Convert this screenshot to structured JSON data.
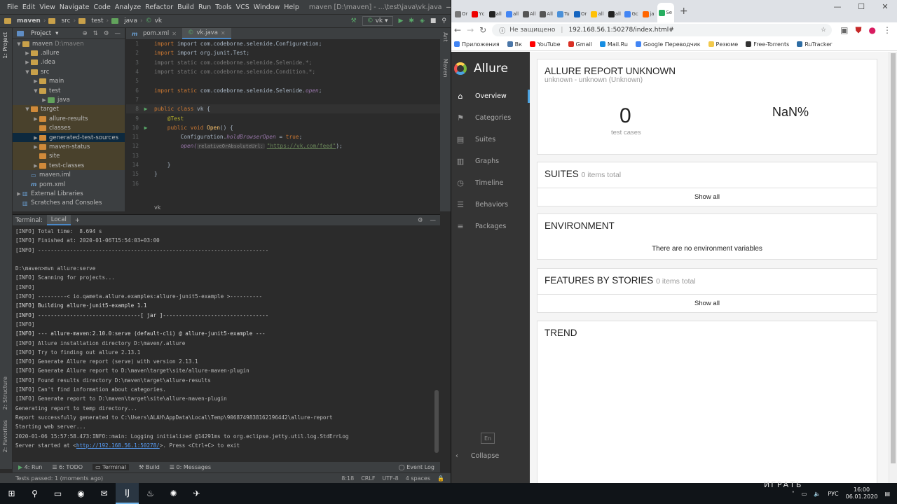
{
  "ide": {
    "menu": [
      "File",
      "Edit",
      "View",
      "Navigate",
      "Code",
      "Analyze",
      "Refactor",
      "Build",
      "Run",
      "Tools",
      "VCS",
      "Window",
      "Help"
    ],
    "title": "maven [D:\\maven] - ...\\test\\java\\vk.java",
    "nav": [
      "maven",
      "src",
      "test",
      "java",
      "vk"
    ],
    "run_config": "vk",
    "project_label": "Project",
    "tree": [
      {
        "label": "maven",
        "dim": "D:\\maven",
        "indent": 0,
        "arrow": "▼",
        "icon": "fold"
      },
      {
        "label": ".allure",
        "indent": 1,
        "arrow": "▶",
        "icon": "fold"
      },
      {
        "label": ".idea",
        "indent": 1,
        "arrow": "▶",
        "icon": "fold"
      },
      {
        "label": "src",
        "indent": 1,
        "arrow": "▼",
        "icon": "fold"
      },
      {
        "label": "main",
        "indent": 2,
        "arrow": "▶",
        "icon": "fold"
      },
      {
        "label": "test",
        "indent": 2,
        "arrow": "▼",
        "icon": "fold"
      },
      {
        "label": "java",
        "indent": 3,
        "arrow": "▶",
        "icon": "fold green"
      },
      {
        "label": "target",
        "indent": 1,
        "arrow": "▼",
        "icon": "fold orange",
        "ex": true
      },
      {
        "label": "allure-results",
        "indent": 2,
        "arrow": "▶",
        "icon": "fold orange",
        "ex": true
      },
      {
        "label": "classes",
        "indent": 2,
        "arrow": "",
        "icon": "fold orange",
        "ex": true
      },
      {
        "label": "generated-test-sources",
        "indent": 2,
        "arrow": "▶",
        "icon": "fold orange",
        "sel": true
      },
      {
        "label": "maven-status",
        "indent": 2,
        "arrow": "▶",
        "icon": "fold orange",
        "ex": true
      },
      {
        "label": "site",
        "indent": 2,
        "arrow": "",
        "icon": "fold orange",
        "ex": true
      },
      {
        "label": "test-classes",
        "indent": 2,
        "arrow": "▶",
        "icon": "fold orange",
        "ex": true
      },
      {
        "label": "maven.iml",
        "indent": 1,
        "arrow": "",
        "icon": "file"
      },
      {
        "label": "pom.xml",
        "indent": 1,
        "arrow": "",
        "icon": "m"
      },
      {
        "label": "External Libraries",
        "indent": 0,
        "arrow": "▶",
        "icon": "lib"
      },
      {
        "label": "Scratches and Consoles",
        "indent": 0,
        "arrow": "",
        "icon": "lib"
      }
    ],
    "tabs": [
      {
        "label": "pom.xml",
        "icon": "m"
      },
      {
        "label": "vk.java",
        "icon": "c",
        "active": true
      }
    ],
    "code": {
      "l1": "import com.codeborne.selenide.Configuration;",
      "l2": "import org.junit.Test;",
      "l3": "import static com.codeborne.selenide.Selenide.*;",
      "l4": "import static com.codeborne.selenide.Condition.*;",
      "l6a": "import static ",
      "l6b": "com.codeborne.selenide.Selenide.",
      "l6c": "open",
      "l8a": "public class ",
      "l8b": "vk {",
      "l9": "@Test",
      "l10a": "public void ",
      "l10b": "Open",
      "l10c": "() {",
      "l11a": "Configuration.",
      "l11b": "holdBrowserOpen",
      " l11c": " = ",
      "l11d": "true",
      "l12a": "open(",
      "l12b": "relativeOrAbsoluteUrl:",
      "l12c": "\"https://vk.com/feed\"",
      "l12d": ");",
      "l14": "}",
      "l15": "}"
    },
    "code_crumb": "vk",
    "terminal_label": "Terminal:",
    "terminal_tab": "Local",
    "terminal_lines": [
      "[INFO] Total time:  8.694 s",
      "[INFO] Finished at: 2020-01-06T15:54:03+03:00",
      "[INFO] ------------------------------------------------------------------------",
      "",
      "D:\\maven>mvn allure:serve",
      "[INFO] Scanning for projects...",
      "[INFO]",
      "[INFO] ---------< io.qameta.allure.examples:allure-junit5-example >----------",
      "[INFO] Building allure-junit5-example 1.1",
      "[INFO] --------------------------------[ jar ]---------------------------------",
      "[INFO]",
      "[INFO] --- allure-maven:2.10.0:serve (default-cli) @ allure-junit5-example ---",
      "[INFO] Allure installation directory D:\\maven/.allure",
      "[INFO] Try to finding out allure 2.13.1",
      "[INFO] Generate Allure report (serve) with version 2.13.1",
      "[INFO] Generate Allure report to D:\\maven\\target\\site/allure-maven-plugin",
      "[INFO] Found results directory D:\\maven\\target\\allure-results",
      "[INFO] Can't find information about categories.",
      "[INFO] Generate report to D:\\maven\\target\\site\\allure-maven-plugin",
      "Generating report to temp directory...",
      "Report successfully generated to C:\\Users\\ALAH\\AppData\\Local\\Temp\\9068749838162196442\\allure-report",
      "Starting web server...",
      "2020-01-06 15:57:58.473:INFO::main: Logging initialized @14291ms to org.eclipse.jetty.util.log.StdErrLog"
    ],
    "server_prefix": "Server started at <",
    "server_url": "http://192.168.56.1:50278/",
    "server_suffix": ">. Press <Ctrl+C> to exit",
    "bottom_tabs": [
      "4: Run",
      "6: TODO",
      "Terminal",
      "Build",
      "0: Messages"
    ],
    "event_log": "Event Log",
    "status_left": "Tests passed: 1 (moments ago)",
    "status_right": [
      "8:18",
      "CRLF",
      "UTF-8",
      "4 spaces"
    ],
    "left_vtabs": [
      "1: Project",
      "2: Structure",
      "2: Favorites"
    ],
    "right_vtabs": [
      "Ant",
      "Maven"
    ]
  },
  "browser": {
    "tab_texts": [
      "Or",
      "Yc",
      "all",
      "all",
      "All",
      "All",
      "Tu",
      "Or",
      "all",
      "all",
      "Gc",
      "ja",
      "Se"
    ],
    "tab_colors": [
      "#777",
      "#e00",
      "#222",
      "#4285f4",
      "#555",
      "#555",
      "#4a90d9",
      "#1565c0",
      "#ffc107",
      "#222",
      "#4285f4",
      "#f60",
      "#27ae60"
    ],
    "not_secure": "Не защищено",
    "url": "192.168.56.1:50278/index.html#",
    "bookmarks": [
      "Приложения",
      "Вк",
      "YouTube",
      "Gmail",
      "Mail.Ru",
      "Google Переводчик",
      "Резюме",
      "Free-Torrents",
      "RuTracker"
    ],
    "bookmark_colors": [
      "#4285f4",
      "#4a76a8",
      "#ff0000",
      "#d93025",
      "#168de2",
      "#4285f4",
      "#f2c94c",
      "#333",
      "#2e6da4"
    ]
  },
  "allure": {
    "brand": "Allure",
    "nav": [
      {
        "label": "Overview",
        "icon": "⌂",
        "active": true
      },
      {
        "label": "Categories",
        "icon": "⚑"
      },
      {
        "label": "Suites",
        "icon": "▤"
      },
      {
        "label": "Graphs",
        "icon": "▥"
      },
      {
        "label": "Timeline",
        "icon": "◷"
      },
      {
        "label": "Behaviors",
        "icon": "☰"
      },
      {
        "label": "Packages",
        "icon": "≡"
      }
    ],
    "lang": "En",
    "collapse": "Collapse",
    "report_title": "ALLURE REPORT UNKNOWN",
    "report_sub": "unknown - unknown (Unknown)",
    "test_count": "0",
    "test_count_label": "test cases",
    "percent": "NaN%",
    "suites_title": "SUITES",
    "suites_count": "0 items total",
    "suites_show": "Show all",
    "env_title": "ENVIRONMENT",
    "env_text": "There are no environment variables",
    "features_title": "FEATURES BY STORIES",
    "features_count": "0 items total",
    "features_show": "Show all",
    "trend_title": "TREND"
  },
  "taskbar": {
    "items": [
      "⊞",
      "⚲",
      "▭",
      "◉",
      "✉",
      "IJ",
      "♨",
      "✺",
      "✈"
    ],
    "lang": "РУС",
    "time": "16:00",
    "date": "06.01.2020",
    "overlay": "ИГРАТЬ"
  }
}
